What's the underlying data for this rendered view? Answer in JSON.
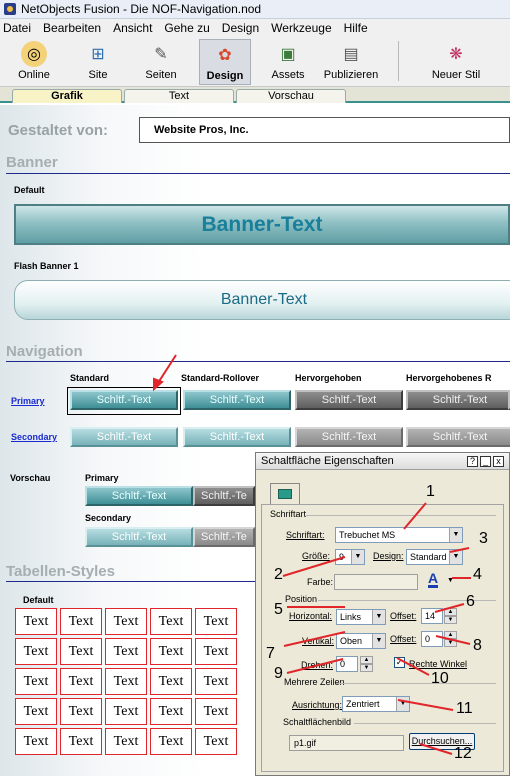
{
  "window": {
    "title": "NetObjects Fusion - Die NOF-Navigation.nod"
  },
  "menu": [
    "Datei",
    "Bearbeiten",
    "Ansicht",
    "Gehe zu",
    "Design",
    "Werkzeuge",
    "Hilfe"
  ],
  "toolbar": {
    "buttons": [
      "Online",
      "Site",
      "Seiten",
      "Design",
      "Assets",
      "Publizieren",
      "Neuer Stil"
    ]
  },
  "tabs": [
    "Grafik",
    "Text",
    "Vorschau"
  ],
  "style": {
    "gestaltet_label": "Gestaltet von:",
    "company": "Website Pros, Inc.",
    "banner_head": "Banner",
    "default_label": "Default",
    "banner_text": "Banner-Text",
    "flash_label": "Flash Banner 1",
    "flash_text": "Banner-Text",
    "navigation_head": "Navigation",
    "columns": [
      "Standard",
      "Standard-Rollover",
      "Hervorgehoben",
      "Hervorgehobenes R"
    ],
    "primary_link": "Primary",
    "secondary_link": "Secondary",
    "button_text": "Schltf.-Text",
    "vorschau_label": "Vorschau",
    "vorschau_primary": "Primary",
    "vorschau_secondary": "Secondary",
    "vorschau_cut": "Schltf.-Te",
    "tabellen_head": "Tabellen-Styles",
    "table_default": "Default",
    "cell_text": "Text"
  },
  "dialog": {
    "title": "Schaltfläche Eigenschaften",
    "ctl_help": "?",
    "ctl_min": "_",
    "ctl_close": "x",
    "schriftart_group": "Schriftart",
    "schriftart_label": "Schriftart:",
    "schriftart_value": "Trebuchet MS",
    "groesse_label": "Größe:",
    "groesse_value": "9",
    "design_label": "Design:",
    "design_value": "Standard",
    "farbe_label": "Farbe:",
    "farbe_icon": "A",
    "position_group": "Position",
    "horizontal_label": "Horizontal:",
    "horizontal_value": "Links",
    "offset_label": "Offset:",
    "offset_h_value": "14",
    "vertikal_label": "Vertikal:",
    "vertikal_value": "Oben",
    "offset_v_value": "0",
    "drehen_label": "Drehen:",
    "drehen_value": "0",
    "rechte_winkel_label": "Rechte Winkel",
    "mehrere_group": "Mehrere Zeilen",
    "ausrichtung_label": "Ausrichtung:",
    "ausrichtung_value": "Zentriert",
    "bild_group": "Schaltflächenbild",
    "bild_value": "p1.gif",
    "browse_label": "Durchsuchen..."
  },
  "annotations": [
    "1",
    "2",
    "3",
    "4",
    "5",
    "6",
    "7",
    "8",
    "9",
    "10",
    "11",
    "12"
  ],
  "colors": {
    "accent_teal": "#3f8e95",
    "annotation_red": "#e0262a",
    "heading_grey": "#a6aeb2"
  }
}
